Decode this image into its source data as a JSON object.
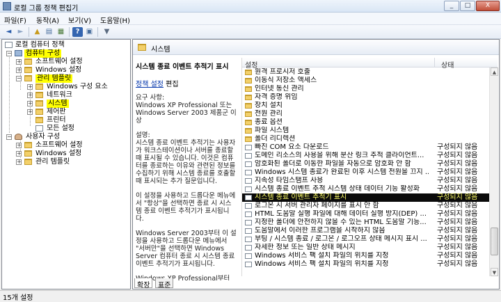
{
  "window": {
    "title": "로컬 그룹 정책 편집기",
    "controls": [
      "_",
      "□",
      "X"
    ]
  },
  "menu": [
    "파일(F)",
    "동작(A)",
    "보기(V)",
    "도움말(H)"
  ],
  "toolbar": {
    "buttons": [
      {
        "name": "back-icon",
        "glyph": "◄"
      },
      {
        "name": "forward-icon",
        "glyph": "►"
      },
      {
        "name": "up-folder-icon",
        "glyph": "▲"
      },
      {
        "name": "show-hide-tree-icon",
        "glyph": "▤"
      },
      {
        "name": "export-list-icon",
        "glyph": "▦"
      },
      {
        "name": "help-icon",
        "glyph": "?"
      },
      {
        "name": "properties-icon",
        "glyph": "▣"
      },
      {
        "name": "filter-icon",
        "glyph": "▼"
      }
    ]
  },
  "tree": {
    "root": "로컬 컴퓨터 정책",
    "computer_config": "컴퓨터 구성",
    "software_settings": "소프트웨어 설정",
    "windows_settings": "Windows 설정",
    "admin_templates": "관리 템플릿",
    "windows_components": "Windows 구성 요소",
    "network": "네트워크",
    "system": "시스템",
    "control_panel": "제어판",
    "printers": "프린터",
    "all_settings": "모든 설정",
    "user_config": "사용자 구성",
    "user_software_settings": "소프트웨어 설정",
    "user_windows_settings": "Windows 설정",
    "user_admin_templates": "관리 템플릿"
  },
  "pane_header": "시스템",
  "description": {
    "title": "시스템 종료 이벤트 추적기 표시",
    "link": "정책 설정",
    "edit_suffix": " 편집",
    "requirements": "요구 사항:\nWindows XP Professional 또는 Windows Server 2003 제품군 이상",
    "desc_label": "설명:",
    "desc_body": "시스템 종료 이벤트 추적기는 사용자가 워크스테이션이나 서버를 종료할 때 표시될 수 있습니다. 이것은 컴퓨터를 종료하는 이유와 관련된 정보를 수집하기 위해 시스템 종료를 호출할 때 표시되는 추가 질문입니다.",
    "para2": "이 설정을 사용하고 드롭다운 메뉴에서 \"항상\"을 선택하면 종료 시 시스템 종료 이벤트 추적기가 표시됩니다.",
    "para3": "Windows Server 2003부터 이 설정을 사용하고 드롭다운 메뉴에서 \"서버만\"을 선택하면 Windows Server 컴퓨터 종료 시 시스템 종료 이벤트 추적기가 표시됩니다.",
    "para4": "Windows XP Professional부터"
  },
  "list": {
    "col_setting": "설정",
    "col_state": "상태",
    "rows": [
      {
        "type": "folder",
        "name": "원격 프로시저 호출",
        "state": ""
      },
      {
        "type": "folder",
        "name": "이동식 저장소 액세스",
        "state": ""
      },
      {
        "type": "folder",
        "name": "인터넷 통신 관리",
        "state": ""
      },
      {
        "type": "folder",
        "name": "자격 증명 위임",
        "state": ""
      },
      {
        "type": "folder",
        "name": "장치 설치",
        "state": ""
      },
      {
        "type": "folder",
        "name": "전원 관리",
        "state": ""
      },
      {
        "type": "folder",
        "name": "종료 옵션",
        "state": ""
      },
      {
        "type": "folder",
        "name": "파일 시스템",
        "state": ""
      },
      {
        "type": "folder",
        "name": "폴더 리디렉션",
        "state": ""
      },
      {
        "type": "setting",
        "name": "빠진 COM 요소 다운로드",
        "state": "구성되지 않음"
      },
      {
        "type": "setting",
        "name": "도메인 리소스의 사용을 위해 분산 링크 추적 클라이언트...",
        "state": "구성되지 않음"
      },
      {
        "type": "setting",
        "name": "암호화된 폴더로 이동한 파일을 자동으로 암호화 안 함",
        "state": "구성되지 않음"
      },
      {
        "type": "setting",
        "name": "Windows 시스템 종료가 완료된 이후 시스템 전원을 끄지 ...",
        "state": "구성되지 않음"
      },
      {
        "type": "setting",
        "name": "지속성 타임스탬프 사용",
        "state": "구성되지 않음"
      },
      {
        "type": "setting",
        "name": "시스템 종료 이벤트 추적 시스템 상태 데이터 기능 활성화",
        "state": "구성되지 않음"
      },
      {
        "type": "setting",
        "name": "시스템 종료 이벤트 추적기 표시",
        "state": "구성되지 않음",
        "selected": true
      },
      {
        "type": "setting",
        "name": "로그온 시 서버 관리자 페이지를 표시 안 함",
        "state": "구성되지 않음"
      },
      {
        "type": "setting",
        "name": "HTML 도움말 실행 파일에 대해 데이터 실행 방지(DEP) ...",
        "state": "구성되지 않음"
      },
      {
        "type": "setting",
        "name": "지정한 폴더에 안전하지 않을 수 있는 HTML 도움말 기능...",
        "state": "구성되지 않음"
      },
      {
        "type": "setting",
        "name": "도움말에서 이러한 프로그램을 시작하지 않음",
        "state": "구성되지 않음"
      },
      {
        "type": "setting",
        "name": "부팅 / 시스템 종료 / 로그온 / 로그오프 상태 메시지 표시 ...",
        "state": "구성되지 않음"
      },
      {
        "type": "setting",
        "name": "자세한 정보 또는 일반 상태 메시지",
        "state": "구성되지 않음"
      },
      {
        "type": "setting",
        "name": "Windows 서비스 팩 설치 파일의 위치를 지정",
        "state": "구성되지 않음"
      },
      {
        "type": "setting",
        "name": "Windows 서비스 팩 설치 파일의 위치를 지정",
        "state": "구성되지 않음"
      }
    ]
  },
  "tabs": [
    "확장",
    "표준"
  ],
  "status": "15개 설정"
}
